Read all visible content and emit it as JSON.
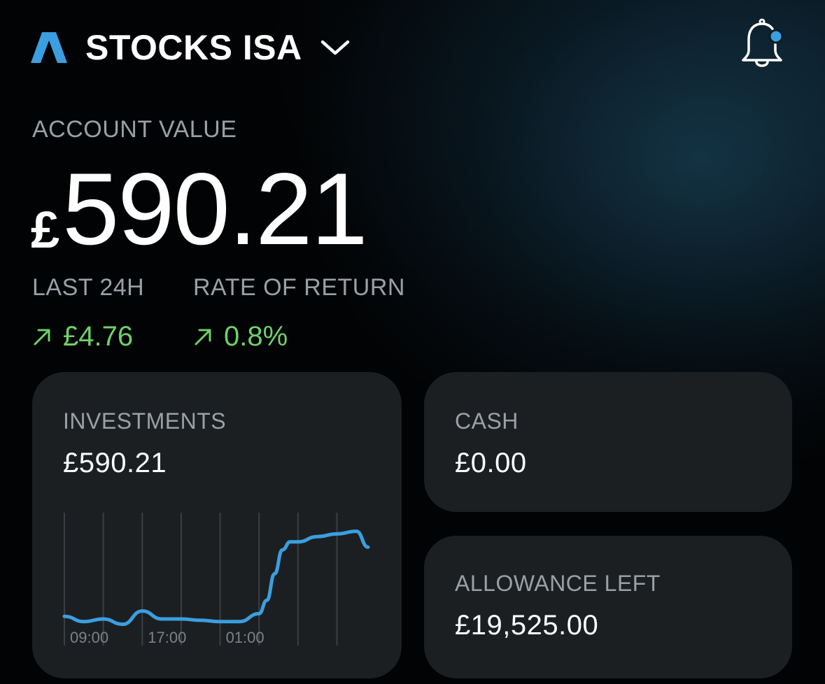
{
  "header": {
    "account_title": "STOCKS ISA",
    "logo_icon": "triangle-a-logo",
    "chevron_icon": "chevron-down-icon",
    "bell_icon": "bell-icon",
    "has_notification": true
  },
  "account": {
    "label": "ACCOUNT VALUE",
    "currency": "£",
    "amount": "590.21"
  },
  "stats": {
    "last24h": {
      "label": "LAST 24H",
      "value": "£4.76",
      "direction": "up"
    },
    "rate_of_return": {
      "label": "RATE OF RETURN",
      "value": "0.8%",
      "direction": "up"
    }
  },
  "cards": {
    "investments": {
      "label": "INVESTMENTS",
      "value": "£590.21"
    },
    "cash": {
      "label": "CASH",
      "value": "£0.00"
    },
    "allowance": {
      "label": "ALLOWANCE LEFT",
      "value": "£19,525.00"
    }
  },
  "colors": {
    "accent_blue": "#3a9fe0",
    "positive_green": "#6fd16a",
    "card_bg": "#1c1f22",
    "label_grey": "#9aa0a6"
  },
  "chart_data": {
    "type": "line",
    "x_tick_labels": [
      "09:00",
      "17:00",
      "01:00"
    ],
    "x": [
      0,
      0.5,
      1,
      1.5,
      2,
      2.5,
      3,
      3.5,
      4,
      4.5,
      5,
      5.2,
      5.4,
      5.6,
      5.8,
      6,
      6.5,
      7,
      7.5,
      7.8
    ],
    "series": [
      {
        "values": [
          588.6,
          588.4,
          588.5,
          588.3,
          588.8,
          588.5,
          588.5,
          588.45,
          588.4,
          588.4,
          588.7,
          589.2,
          590.2,
          591.1,
          591.4,
          591.4,
          591.6,
          591.7,
          591.8,
          591.2
        ]
      }
    ],
    "ylim": [
      587.5,
      592.5
    ],
    "xlim": [
      0,
      7.8
    ],
    "gridlines_x": [
      0,
      1,
      2,
      3,
      4,
      5,
      6,
      7
    ],
    "line_color": "#3a9fe0",
    "grid": true
  }
}
